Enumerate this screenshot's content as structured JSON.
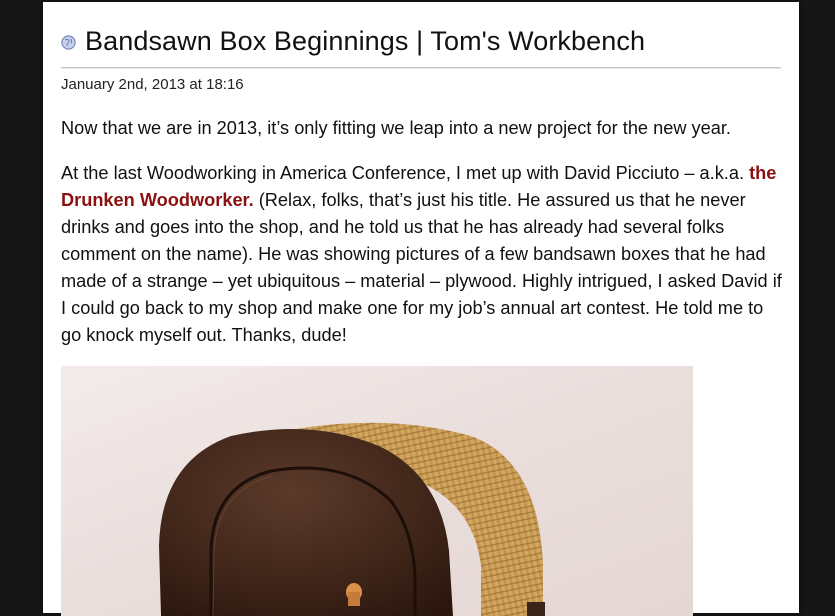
{
  "post": {
    "title": "Bandsawn Box Beginnings | Tom's Workbench",
    "date": "January 2nd, 2013 at 18:16",
    "paragraph1": "Now that we are in 2013, it’s only fitting we leap into a new project for the new year.",
    "paragraph2_before": "At the last Woodworking in America Conference, I met up with David Picciuto – a.k.a. ",
    "paragraph2_link": "the Drunken Woodworker.",
    "paragraph2_after": " (Relax, folks, that’s just his title. He assured us that he never drinks and goes into the shop, and he told us that he has already had several folks comment on the name). He was showing pictures of a few bandsawn boxes that he had made of a strange – yet ubiquitous – material – plywood. Highly intrigued, I asked David if I could go back to my shop and make one for my job’s annual art contest. He told me to go knock myself out. Thanks, dude!"
  },
  "icons": {
    "title_icon": "globe-icon"
  },
  "colors": {
    "link": "#8b1010",
    "background": "#161616",
    "page": "#ffffff"
  }
}
